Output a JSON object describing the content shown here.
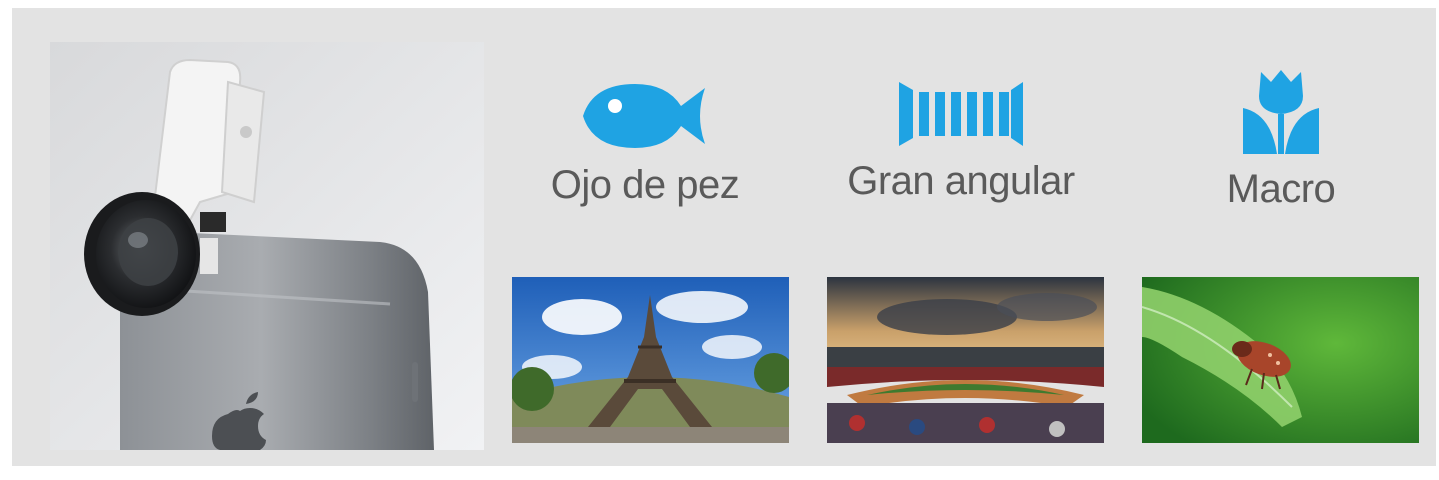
{
  "accent_color": "#1fa3e3",
  "panel_color": "#e3e3e3",
  "label_color": "#5a5a5a",
  "product_image": {
    "description_icon": "phone-with-clip-lens"
  },
  "lens_types": [
    {
      "label": "Ojo de pez",
      "icon": "fish-icon",
      "photo": "eiffel-tower-fisheye-photo"
    },
    {
      "label": "Gran angular",
      "icon": "wide-angle-icon",
      "photo": "stadium-wide-angle-photo"
    },
    {
      "label": "Macro",
      "icon": "tulip-icon",
      "photo": "beetle-macro-photo"
    }
  ]
}
